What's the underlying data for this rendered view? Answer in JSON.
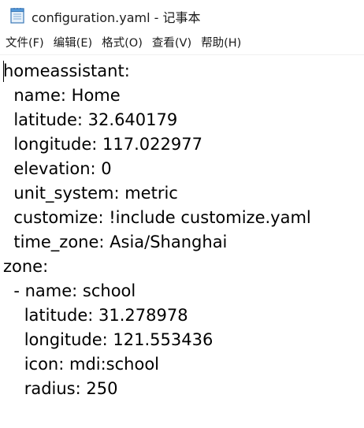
{
  "window": {
    "title": "configuration.yaml - 记事本",
    "icon": "notepad-icon"
  },
  "menu": {
    "items": [
      {
        "label": "文件(F)"
      },
      {
        "label": "编辑(E)"
      },
      {
        "label": "格式(O)"
      },
      {
        "label": "查看(V)"
      },
      {
        "label": "帮助(H)"
      }
    ]
  },
  "editor": {
    "lines": [
      "homeassistant:",
      "  name: Home",
      "  latitude: 32.640179",
      "  longitude: 117.022977",
      "  elevation: 0",
      "  unit_system: metric",
      "  customize: !include customize.yaml",
      "  time_zone: Asia/Shanghai",
      "zone:",
      "  - name: school",
      "    latitude: 31.278978",
      "    longitude: 121.553436",
      "    icon: mdi:school",
      "    radius: 250"
    ]
  }
}
